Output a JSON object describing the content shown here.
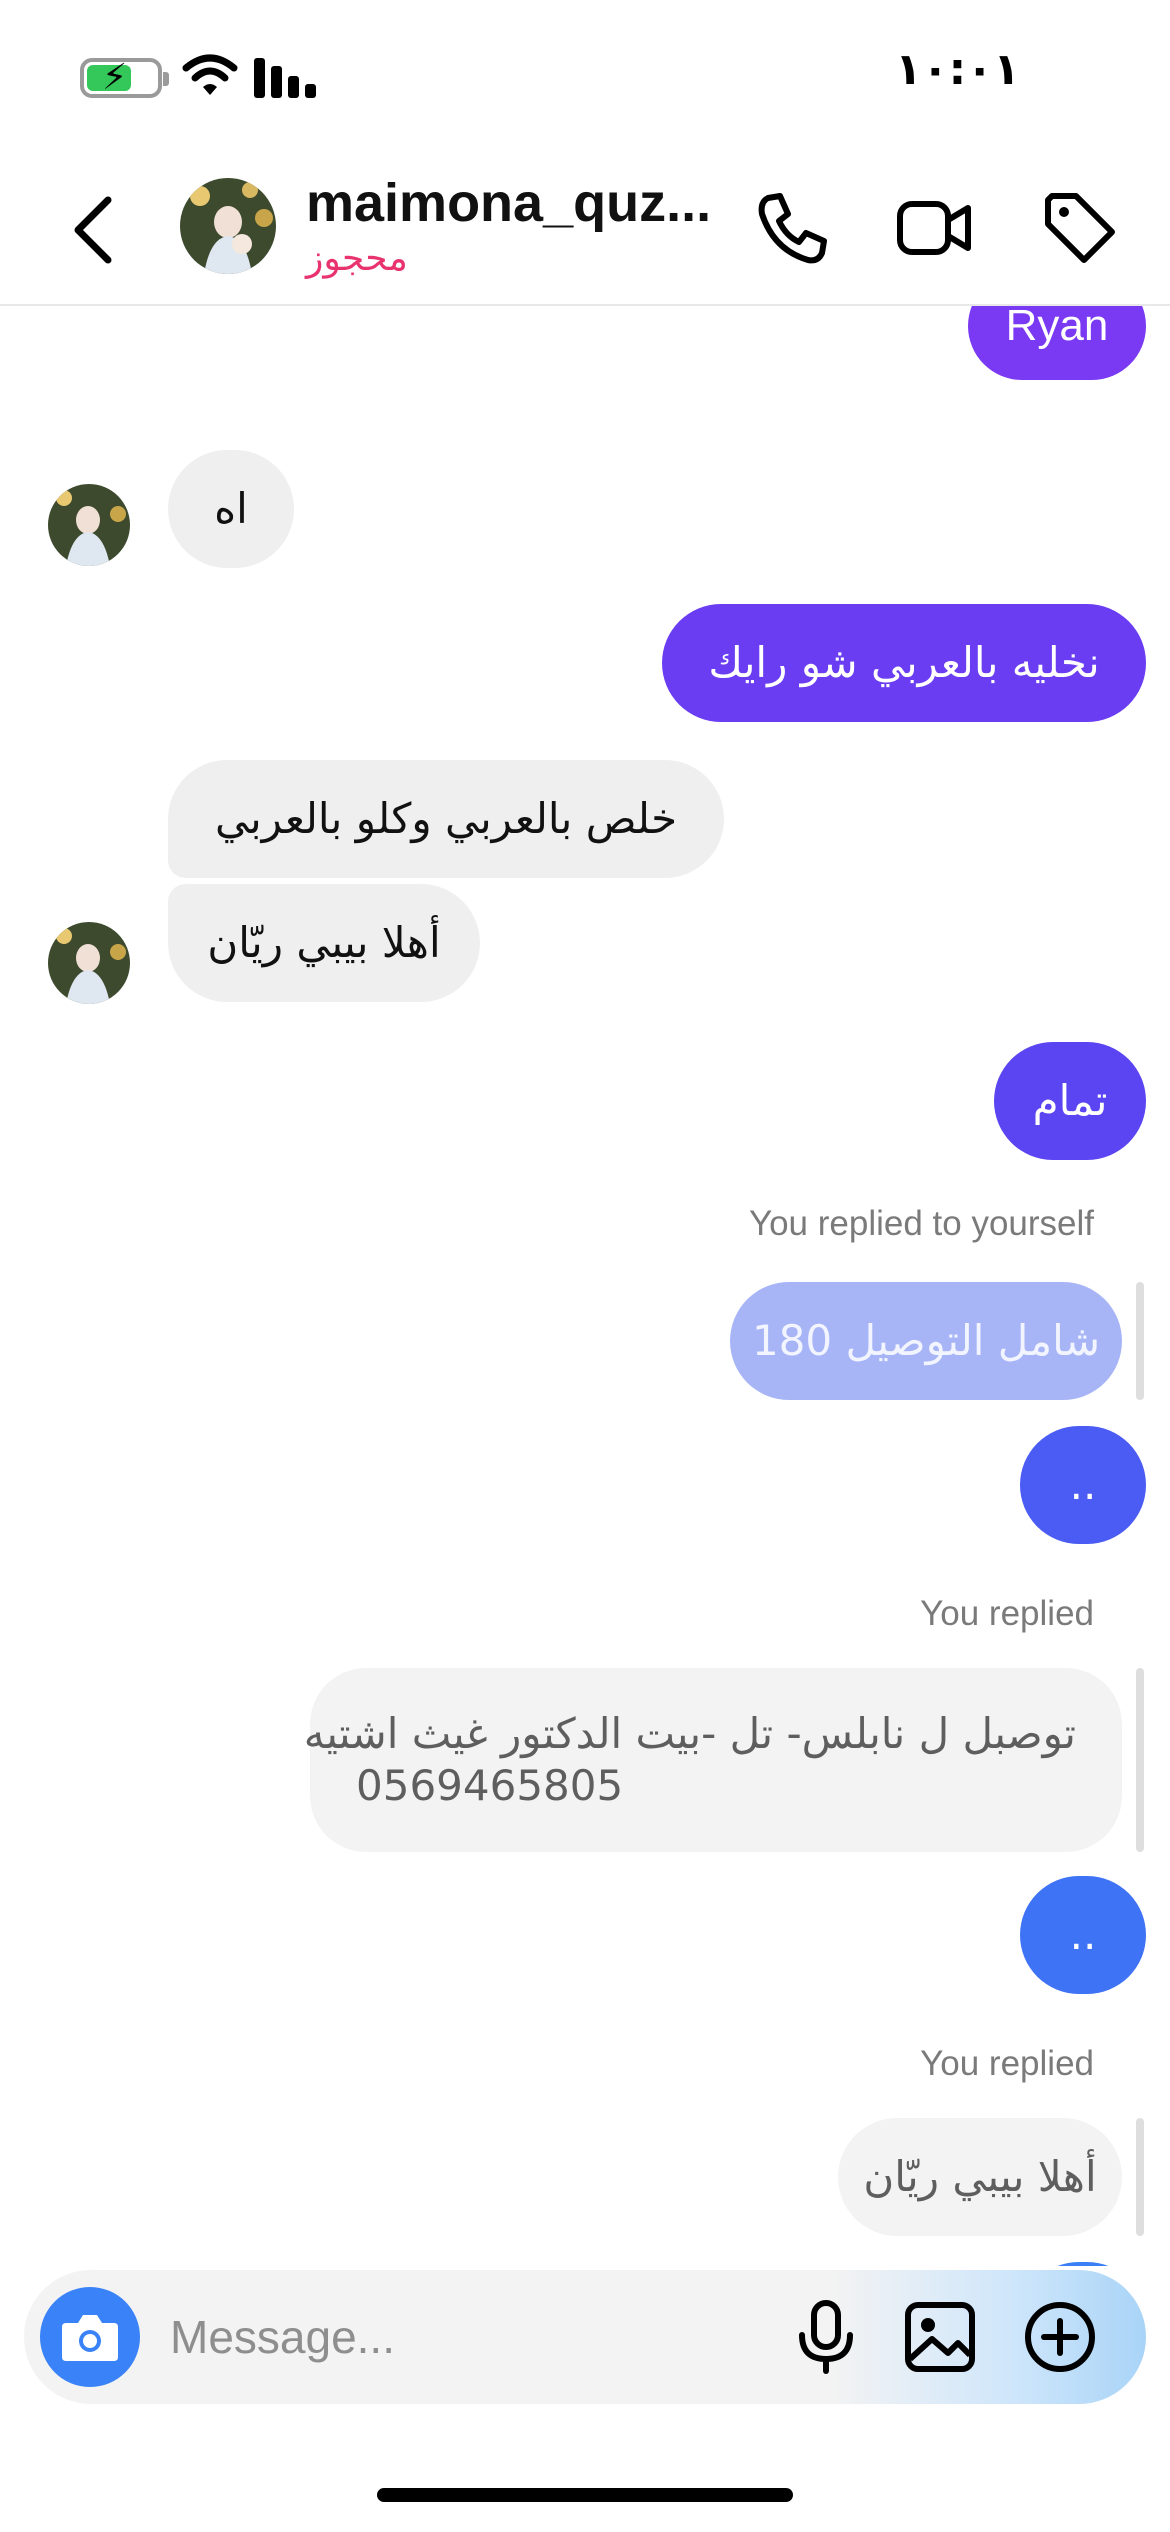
{
  "status_bar": {
    "time": "١٠:٠١"
  },
  "header": {
    "contact_name": "maimona_quz...",
    "contact_status": "محجوز"
  },
  "messages": [
    {
      "type": "outgoing",
      "text": "Ryan",
      "color": "#7a39f2"
    },
    {
      "type": "incoming",
      "text": "اه"
    },
    {
      "type": "outgoing",
      "text": "نخليه بالعربي شو رايك",
      "color": "#6a3df2"
    },
    {
      "type": "incoming",
      "text": "خلص بالعربي وكلو بالعربي"
    },
    {
      "type": "incoming",
      "text": "أهلا بيبي ريّان"
    },
    {
      "type": "outgoing",
      "text": "تمام",
      "color": "#5b44f2"
    },
    {
      "type": "reply-context",
      "label": "You replied to yourself",
      "quoted": "180 شامل التوصيل",
      "color": "#a7b5f6"
    },
    {
      "type": "outgoing",
      "text": "..",
      "color": "#4a5cf4"
    },
    {
      "type": "reply-context",
      "label": "You replied",
      "quoted": "توصبل ل نابلس- تل -بيت الدكتور غيث اشتيه",
      "quoted_line2": "0569465805"
    },
    {
      "type": "outgoing",
      "text": "..",
      "color": "#3f73f5"
    },
    {
      "type": "reply-context",
      "label": "You replied",
      "quoted": "أهلا بيبي ريّان"
    }
  ],
  "composer": {
    "placeholder": "Message..."
  },
  "colors": {
    "accent_blue": "#3a82f7",
    "status_pink": "#e8336f"
  }
}
